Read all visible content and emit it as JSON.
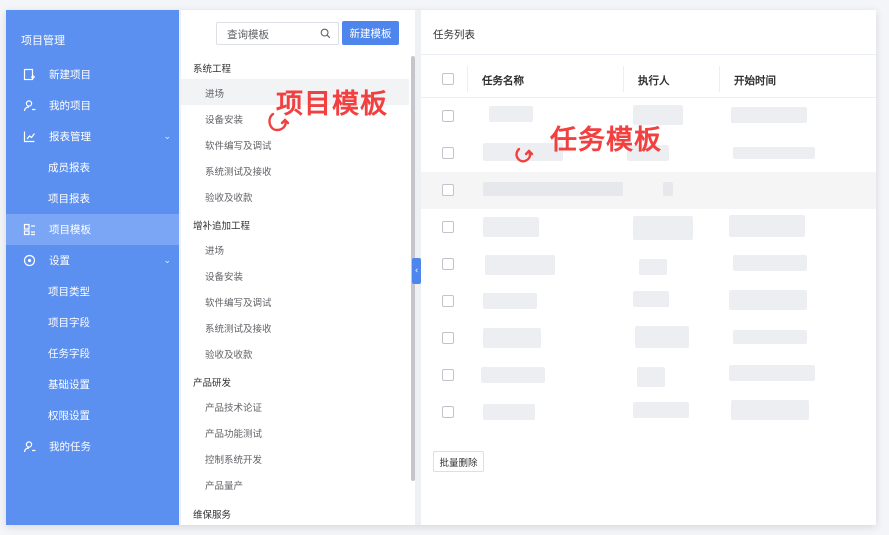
{
  "sidebar": {
    "title": "项目管理",
    "items": [
      {
        "label": "新建项目",
        "icon": "add-doc-icon"
      },
      {
        "label": "我的项目",
        "icon": "user-icon"
      },
      {
        "label": "报表管理",
        "icon": "chart-icon"
      },
      {
        "label": "成员报表"
      },
      {
        "label": "项目报表"
      },
      {
        "label": "项目模板",
        "icon": "template-icon",
        "active": true
      },
      {
        "label": "设置",
        "icon": "settings-icon"
      },
      {
        "label": "项目类型"
      },
      {
        "label": "项目字段"
      },
      {
        "label": "任务字段"
      },
      {
        "label": "基础设置"
      },
      {
        "label": "权限设置"
      },
      {
        "label": "我的任务",
        "icon": "user-task-icon"
      }
    ]
  },
  "templates": {
    "search_placeholder": "查询模板",
    "new_button": "新建模板",
    "groups": [
      {
        "name": "系统工程",
        "items": [
          "进场",
          "设备安装",
          "软件编写及调试",
          "系统测试及接收",
          "验收及收款"
        ]
      },
      {
        "name": "增补追加工程",
        "items": [
          "进场",
          "设备安装",
          "软件编写及调试",
          "系统测试及接收",
          "验收及收款"
        ]
      },
      {
        "name": "产品研发",
        "items": [
          "产品技术论证",
          "产品功能测试",
          "控制系统开发",
          "产品量产"
        ]
      },
      {
        "name": "维保服务",
        "items": []
      }
    ],
    "annotation": "项目模板"
  },
  "tasks": {
    "title": "任务列表",
    "columns": [
      "任务名称",
      "执行人",
      "开始时间"
    ],
    "batch_delete": "批量删除",
    "annotation": "任务模板"
  },
  "colors": {
    "sidebar_bg": "#5b8ff0",
    "sidebar_active": "#7aa6f5",
    "primary": "#4f86ee",
    "annotation": "#f24040"
  }
}
